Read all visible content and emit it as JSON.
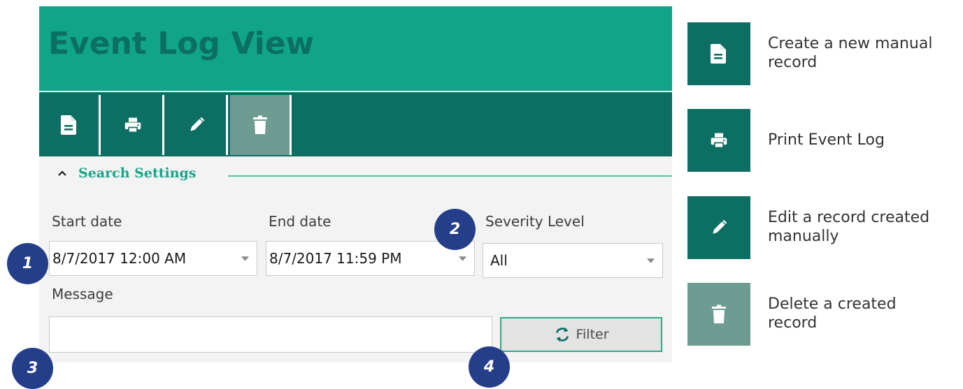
{
  "window": {
    "title": "Event Log View"
  },
  "toolbar": {
    "buttons": [
      {
        "icon": "new-document-icon",
        "enabled": true
      },
      {
        "icon": "print-icon",
        "enabled": true
      },
      {
        "icon": "edit-pencil-icon",
        "enabled": true
      },
      {
        "icon": "trash-icon",
        "enabled": false
      }
    ]
  },
  "search_settings": {
    "title": "Search Settings",
    "expanded": true,
    "start_date": {
      "label": "Start date",
      "value": "8/7/2017 12:00 AM"
    },
    "end_date": {
      "label": "End date",
      "value": "8/7/2017 11:59 PM"
    },
    "severity": {
      "label": "Severity Level",
      "value": "All"
    },
    "message": {
      "label": "Message",
      "value": ""
    },
    "filter_label": "Filter"
  },
  "callouts": [
    "1",
    "2",
    "3",
    "4"
  ],
  "legend": [
    {
      "icon": "new-document-icon",
      "text": "Create a new manual record"
    },
    {
      "icon": "print-icon",
      "text": "Print Event Log"
    },
    {
      "icon": "edit-pencil-icon",
      "text": "Edit a record created manually"
    },
    {
      "icon": "trash-icon",
      "text": "Delete a created record"
    }
  ],
  "colors": {
    "title_bar": "#10a58a",
    "title_text": "#0b6f62",
    "toolbar": "#0d6e63",
    "disabled_button": "#6e9c92",
    "accent": "#18a389",
    "badge": "#243e89"
  }
}
